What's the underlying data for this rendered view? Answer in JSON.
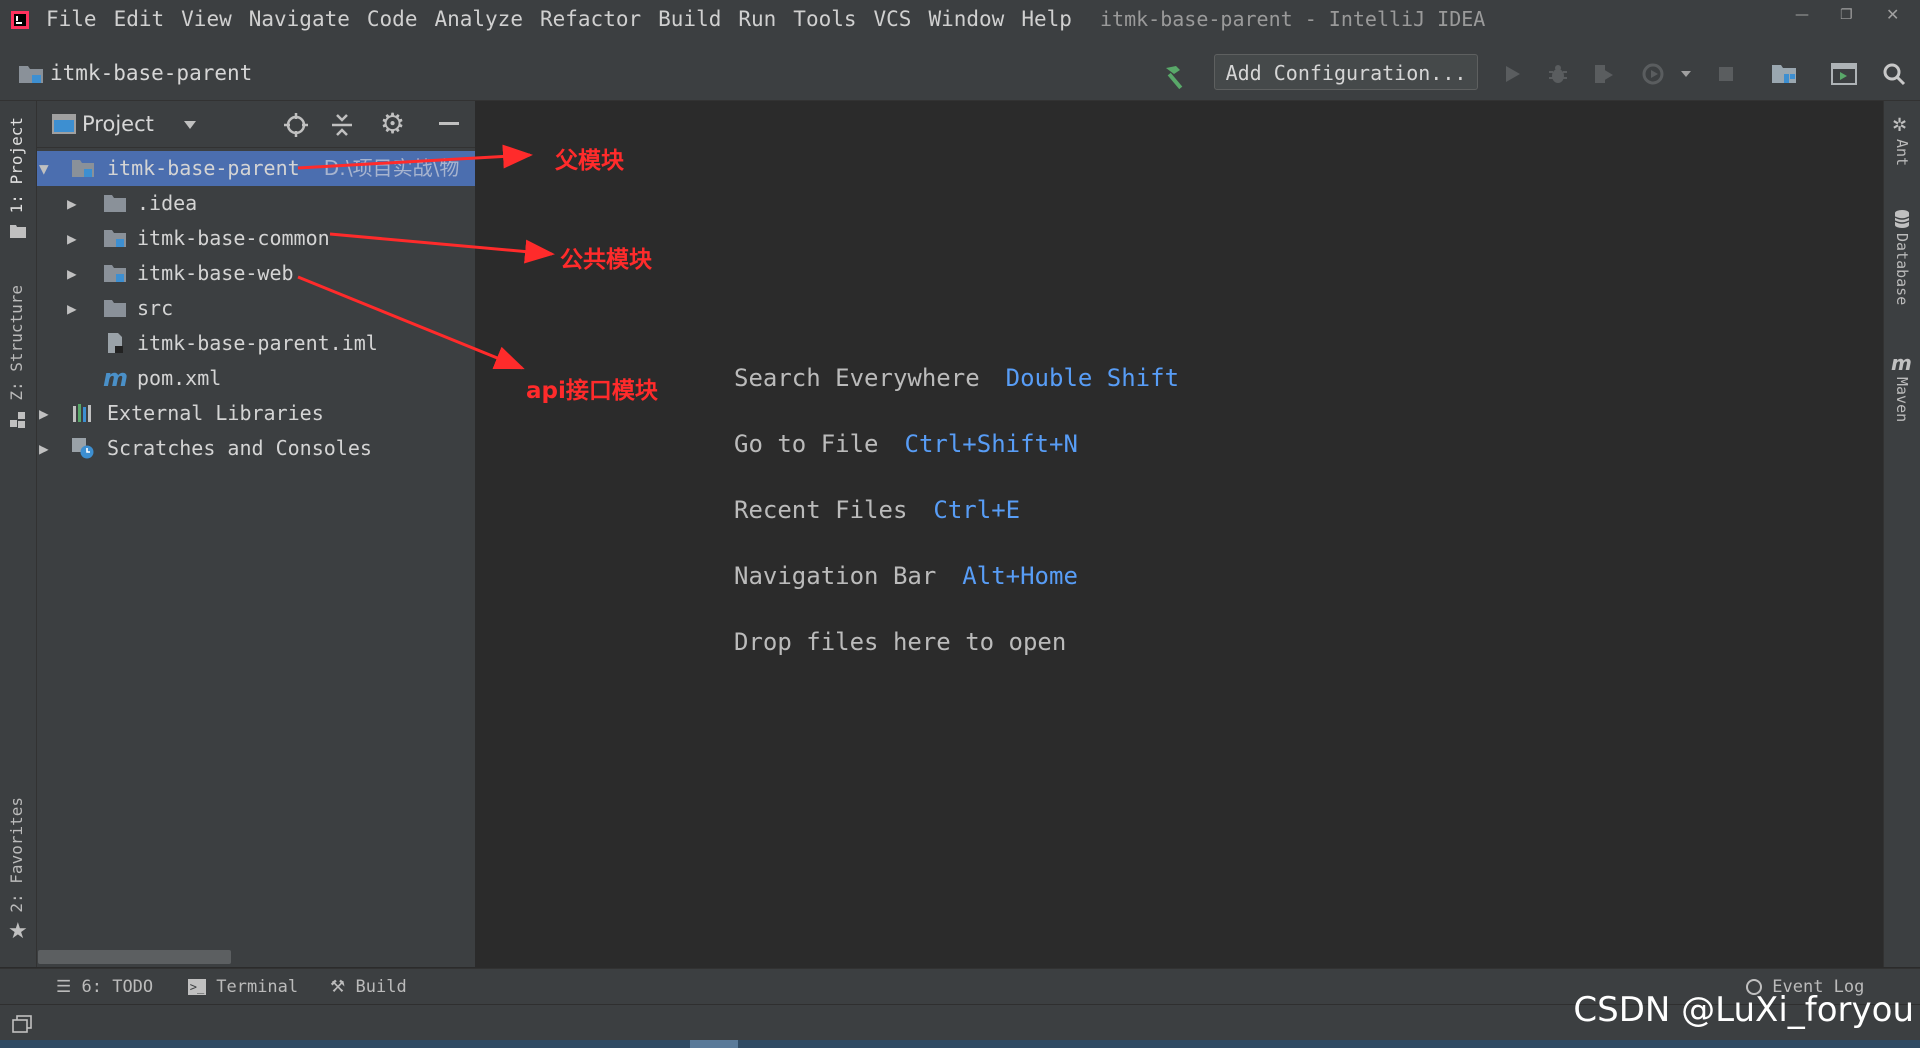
{
  "menubar": {
    "items": [
      "File",
      "Edit",
      "View",
      "Navigate",
      "Code",
      "Analyze",
      "Refactor",
      "Build",
      "Run",
      "Tools",
      "VCS",
      "Window",
      "Help"
    ],
    "window_title": "itmk-base-parent - IntelliJ IDEA"
  },
  "navbar": {
    "breadcrumb": "itmk-base-parent",
    "config_button": "Add Configuration..."
  },
  "left_stripe": {
    "project_tab": "1: Project",
    "structure_tab": "Z: Structure",
    "favorites_tab": "2: Favorites"
  },
  "right_stripe": {
    "ant_tab": "Ant",
    "database_tab": "Database",
    "maven_tab": "Maven"
  },
  "project_panel": {
    "title": "Project",
    "tree": [
      {
        "label": "itmk-base-parent",
        "path": "D:\\项目实战\\物"
      },
      {
        "label": ".idea"
      },
      {
        "label": "itmk-base-common"
      },
      {
        "label": "itmk-base-web"
      },
      {
        "label": "src"
      },
      {
        "label": "itmk-base-parent.iml"
      },
      {
        "label": "pom.xml"
      },
      {
        "label": "External Libraries"
      },
      {
        "label": "Scratches and Consoles"
      }
    ]
  },
  "editor": {
    "hints": [
      {
        "text": "Search Everywhere",
        "key": "Double Shift"
      },
      {
        "text": "Go to File",
        "key": "Ctrl+Shift+N"
      },
      {
        "text": "Recent Files",
        "key": "Ctrl+E"
      },
      {
        "text": "Navigation Bar",
        "key": "Alt+Home"
      },
      {
        "text": "Drop files here to open",
        "key": ""
      }
    ]
  },
  "annotations": {
    "parent": "父模块",
    "common": "公共模块",
    "api": "api接口模块"
  },
  "bottombar": {
    "todo": "6: TODO",
    "terminal": "Terminal",
    "build": "Build",
    "event_log": "Event Log"
  },
  "watermark": "CSDN @LuXi_foryou",
  "colors": {
    "panel_bg": "#3c3f41",
    "editor_bg": "#2b2b2b",
    "selection": "#4b6eaf",
    "shortcut_blue": "#589df6",
    "annotation_red": "#ff2b2b"
  }
}
